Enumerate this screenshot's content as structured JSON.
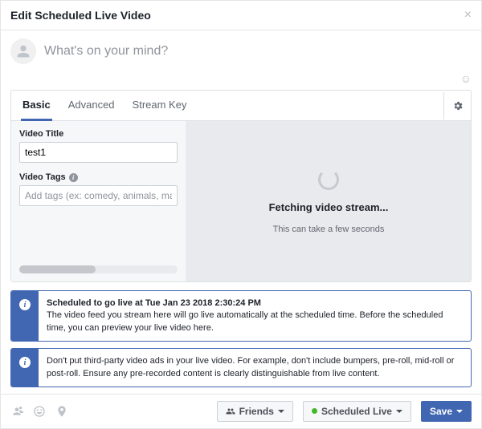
{
  "dialog": {
    "title": "Edit Scheduled Live Video"
  },
  "composer": {
    "placeholder": "What's on your mind?"
  },
  "tabs": {
    "basic": "Basic",
    "advanced": "Advanced",
    "streamKey": "Stream Key"
  },
  "fields": {
    "videoTitle": {
      "label": "Video Title",
      "value": "test1"
    },
    "videoTags": {
      "label": "Video Tags",
      "placeholder": "Add tags (ex: comedy, animals, make-up etc.)"
    }
  },
  "preview": {
    "title": "Fetching video stream...",
    "subtitle": "This can take a few seconds"
  },
  "notices": {
    "scheduled": {
      "title": "Scheduled to go live at Tue Jan 23 2018 2:30:24 PM",
      "body": "The video feed you stream here will go live automatically at the scheduled time. Before the scheduled time, you can preview your live video here."
    },
    "ads": {
      "body": "Don't put third-party video ads in your live video. For example, don't include bumpers, pre-roll, mid-roll or post-roll. Ensure any pre-recorded content is clearly distinguishable from live content."
    }
  },
  "footer": {
    "friends": "Friends",
    "scheduledLive": "Scheduled Live",
    "save": "Save"
  }
}
